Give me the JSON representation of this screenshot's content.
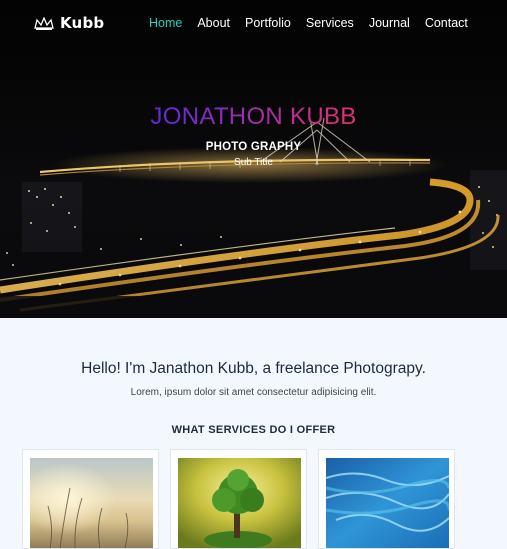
{
  "brand": {
    "name": "Kubb",
    "icon": "crown-logo-icon"
  },
  "nav": {
    "items": [
      {
        "label": "Home",
        "active": true
      },
      {
        "label": "About",
        "active": false
      },
      {
        "label": "Portfolio",
        "active": false
      },
      {
        "label": "Services",
        "active": false
      },
      {
        "label": "Journal",
        "active": false
      },
      {
        "label": "Contact",
        "active": false
      }
    ],
    "active_color": "#18d6c1"
  },
  "hero": {
    "title": "JONATHON KUBB",
    "tagline": "PHOTO GRAPHY",
    "subtitle": "Sub Title",
    "title_gradient": [
      "#5a2bd6",
      "#e6306e"
    ]
  },
  "intro": {
    "heading": "Hello! I'm Janathon Kubb, a freelance Photograpy.",
    "text": "Lorem, ipsum dolor sit amet consectetur adipisicing elit."
  },
  "services": {
    "heading": "WHAT SERVICES DO I OFFER",
    "cards": [
      {
        "image": "grass-sunset-photo"
      },
      {
        "image": "tree-photo"
      },
      {
        "image": "ocean-aerial-photo"
      }
    ]
  }
}
